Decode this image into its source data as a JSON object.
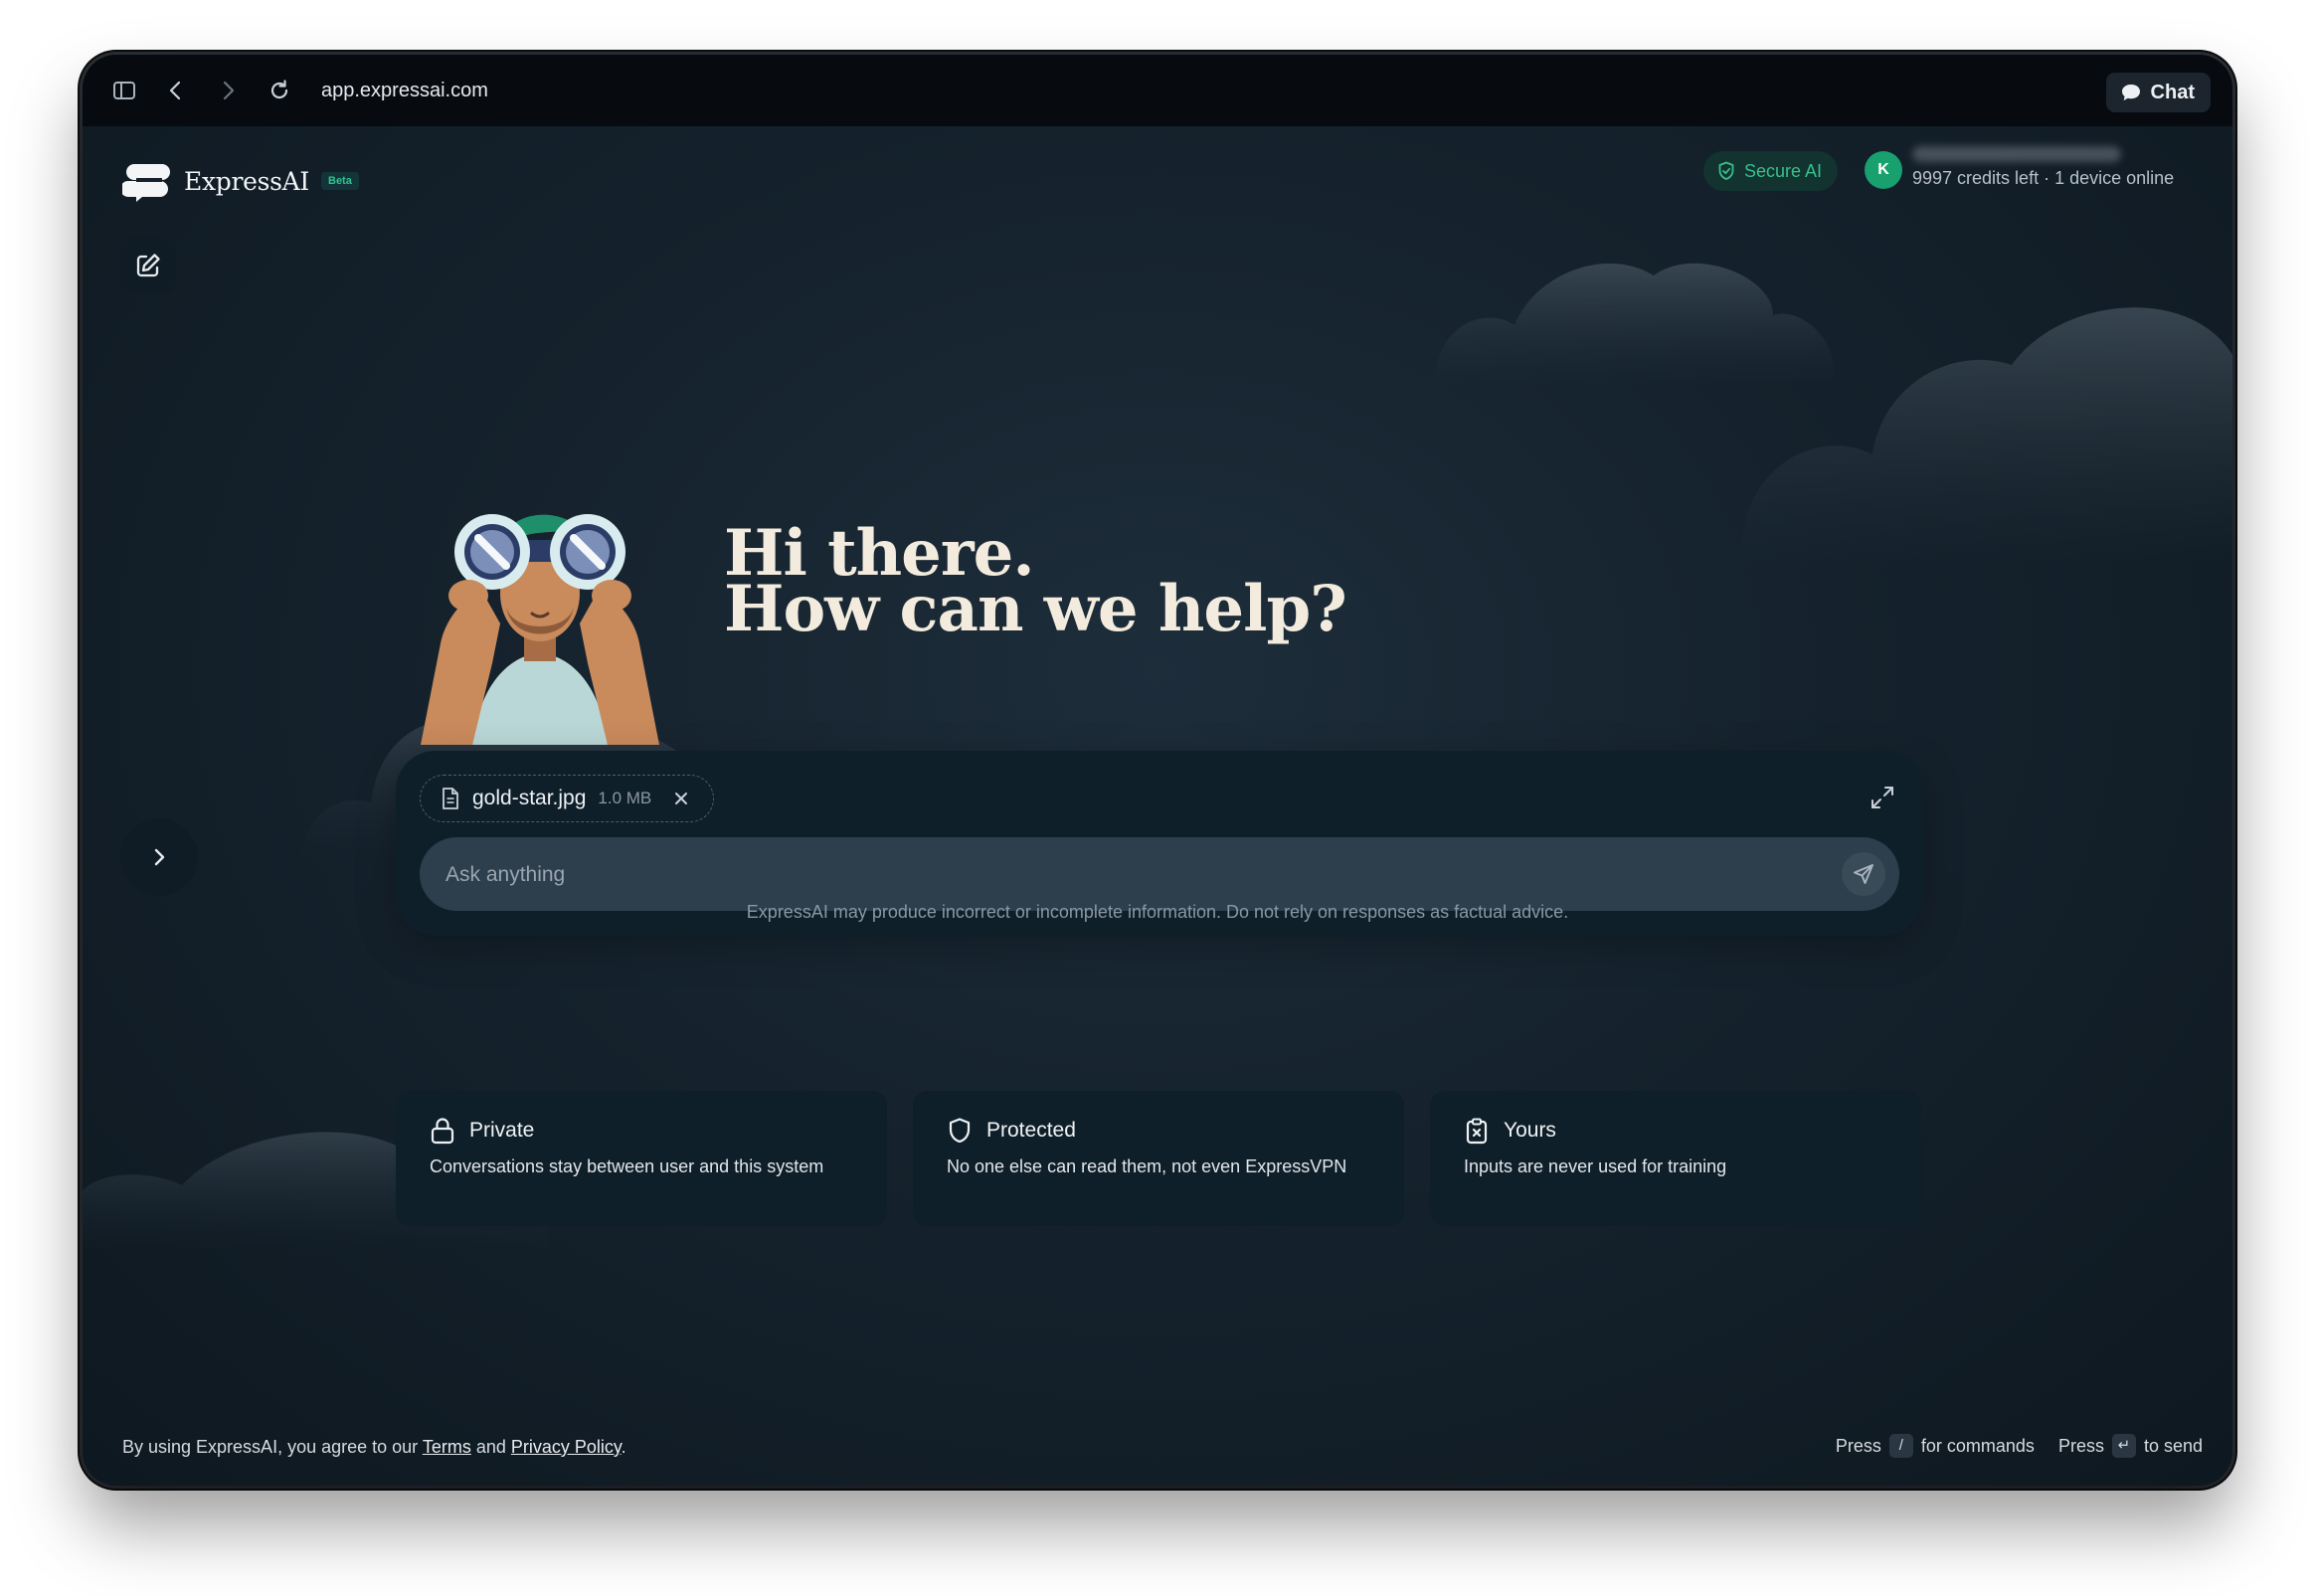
{
  "browser": {
    "url": "app.expressai.com",
    "chat_label": "Chat"
  },
  "header": {
    "brand_name": "ExpressAI",
    "beta_label": "Beta",
    "secure_label": "Secure AI",
    "avatar_initial": "K",
    "account_status": "9997 credits left · 1 device online"
  },
  "main": {
    "greeting_line1": "Hi there.",
    "greeting_line2": "How can we help?",
    "attachment": {
      "file_name": "gold-star.jpg",
      "file_size": "1.0 MB"
    },
    "input_placeholder": "Ask anything",
    "disclaimer": "ExpressAI may produce incorrect or incomplete information. Do not rely on responses as factual advice."
  },
  "features": [
    {
      "title": "Private",
      "description": "Conversations stay between user and this system",
      "icon": "lock-icon"
    },
    {
      "title": "Protected",
      "description": "No one else can read them, not even ExpressVPN",
      "icon": "shield-icon"
    },
    {
      "title": "Yours",
      "description": "Inputs are never used for training",
      "icon": "clipboard-x-icon"
    }
  ],
  "footer": {
    "prefix": "By using ExpressAI, you agree to our ",
    "terms": "Terms",
    "and": " and ",
    "privacy": "Privacy Policy",
    "suffix": ".",
    "press1": "Press",
    "key1": "/",
    "commands": "for commands",
    "press2": "Press",
    "key2": "↵",
    "send": "to send"
  },
  "colors": {
    "background": "#15222d",
    "accent_green": "#37c08a",
    "greeting_text": "#f3ecde",
    "composer_bg": "#0f1f2a"
  }
}
